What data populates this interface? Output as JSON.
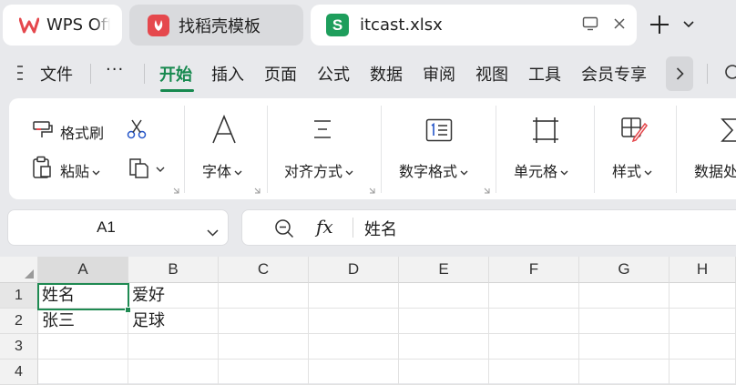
{
  "tabs": [
    {
      "title": "WPS Office",
      "icon": "wps-logo-icon"
    },
    {
      "title": "找稻壳模板",
      "icon": "docer-logo-icon"
    },
    {
      "title": "itcast.xlsx",
      "icon": "spreadsheet-s-icon",
      "logo_letter": "S"
    }
  ],
  "menu": {
    "file": "文件",
    "more": "···",
    "items": [
      "开始",
      "插入",
      "页面",
      "公式",
      "数据",
      "审阅",
      "视图",
      "工具",
      "会员专享"
    ],
    "active": "开始"
  },
  "ribbon": {
    "format_painter": "格式刷",
    "paste": "粘贴",
    "font": "字体",
    "align": "对齐方式",
    "number_format": "数字格式",
    "cell": "单元格",
    "style": "样式",
    "data": "数据处理"
  },
  "formula": {
    "cell_ref": "A1",
    "fx_label": "fx",
    "content": "姓名"
  },
  "sheet": {
    "columns": [
      "A",
      "B",
      "C",
      "D",
      "E",
      "F",
      "G",
      "H"
    ],
    "rows": [
      "1",
      "2",
      "3",
      "4"
    ],
    "cells": [
      [
        "姓名",
        "爱好"
      ],
      [
        "张三",
        "足球"
      ]
    ],
    "active_cell": "A1"
  },
  "colors": {
    "accent": "#17894f",
    "spreadsheet_icon": "#1e9e5c",
    "wps_logo": "#e5484d"
  }
}
